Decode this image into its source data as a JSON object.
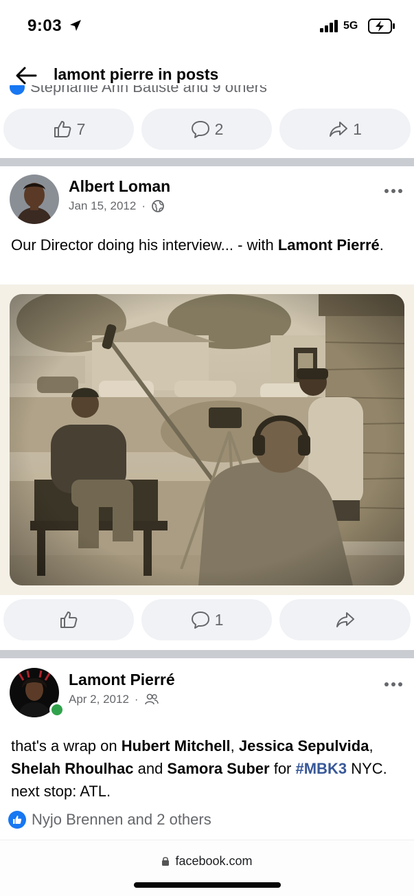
{
  "status_bar": {
    "time": "9:03",
    "network": "5G"
  },
  "header": {
    "title": "lamont pierre in posts"
  },
  "prev_post": {
    "clipped_reactions": "Stephanie Ann Batiste and 9 others",
    "likes": "7",
    "comments": "2",
    "shares": "1"
  },
  "post1": {
    "author": "Albert Loman",
    "date": "Jan 15, 2012",
    "dot": "·",
    "privacy_icon": "globe-icon",
    "text_before": "Our Director doing his interview... - with ",
    "text_bold": "Lamont Pierré",
    "text_after": ".",
    "comments": "1"
  },
  "post2": {
    "author": "Lamont Pierré",
    "date": "Apr 2, 2012",
    "dot": "·",
    "privacy_icon": "friends-icon",
    "text": {
      "t1": "that's a wrap on ",
      "n1": "Hubert Mitchell",
      "t2": ", ",
      "n2": "Jessica Sepulvida",
      "t3": ", ",
      "n3": "Shelah Rhoulhac",
      "t4": " and ",
      "n4": "Samora Suber",
      "t5": " for ",
      "hashtag": "#MBK3",
      "t6": " NYC.  next stop: ATL."
    },
    "reactions": "Nyjo Brennen and 2 others"
  },
  "browser": {
    "url": "facebook.com"
  },
  "colors": {
    "accent": "#1877f2",
    "online": "#31a24c",
    "button_bg": "#f0f2f5",
    "muted": "#65676b"
  }
}
